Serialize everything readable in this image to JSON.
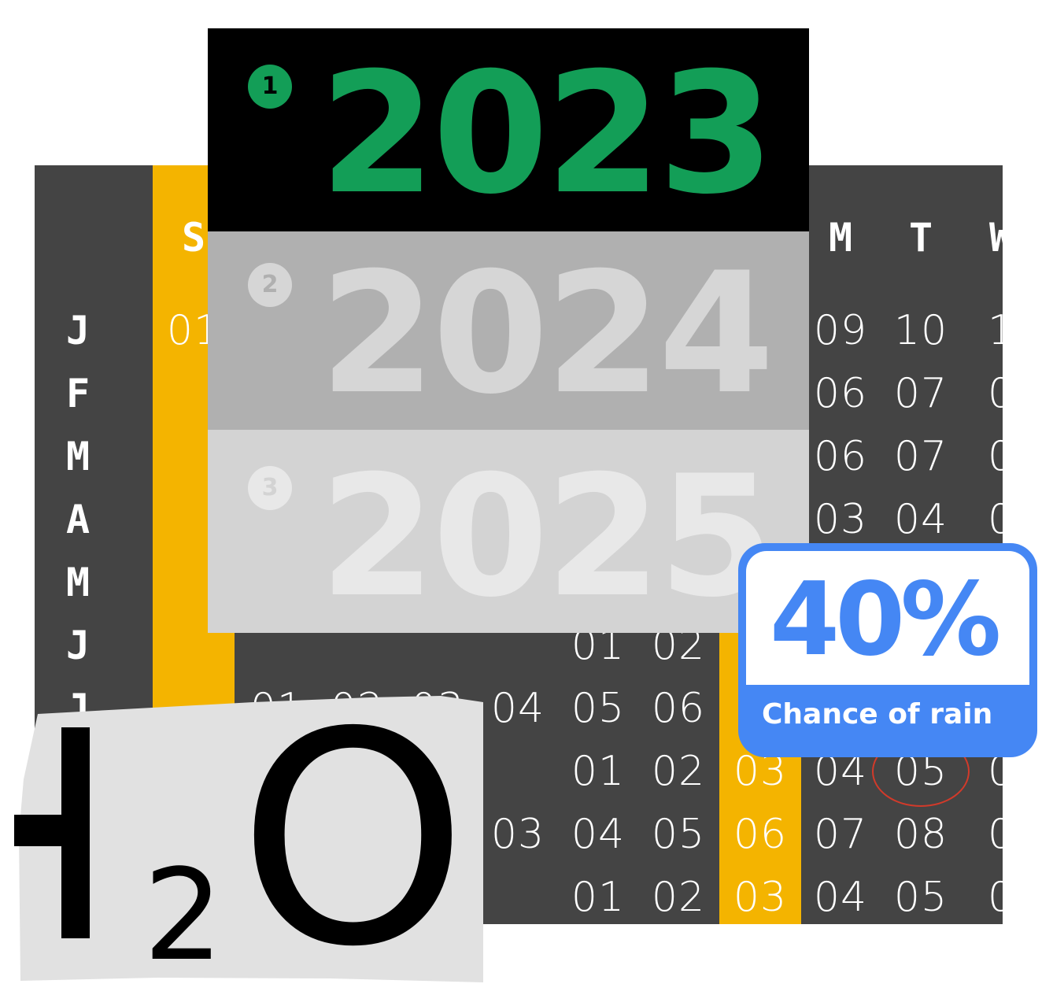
{
  "calendar": {
    "weekday_headers": [
      "S",
      "M",
      "T",
      "W"
    ],
    "months": [
      "J",
      "F",
      "M",
      "A",
      "M",
      "J",
      "J"
    ],
    "rows": [
      {
        "sun": "01",
        "mon": "09",
        "tue": "10",
        "wed": "1"
      },
      {
        "mon": "06",
        "tue": "07",
        "wed": "0"
      },
      {
        "mon": "06",
        "tue": "07",
        "wed": "0"
      },
      {
        "mon": "03",
        "tue": "04",
        "wed": "0"
      }
    ],
    "lower_rows": [
      [
        "01",
        "02"
      ],
      [
        "01",
        "02",
        "03",
        "04",
        "05",
        "06"
      ],
      [
        "01",
        "02",
        "03",
        "04",
        "05",
        "0"
      ],
      [
        "03",
        "04",
        "05",
        "06",
        "07",
        "08",
        "0"
      ],
      [
        "01",
        "02",
        "03",
        "04",
        "05",
        "0"
      ]
    ],
    "highlighted_day": "05",
    "colors": {
      "background": "#444444",
      "sunday": "#f4b400",
      "text": "#ffffff",
      "highlight_ring": "#d23a2a"
    }
  },
  "years": [
    {
      "badge": "1",
      "year": "2023",
      "bg": "#000000",
      "fg": "#139e57",
      "badge_text": "#000000"
    },
    {
      "badge": "2",
      "year": "2024",
      "bg": "#b0b0b0",
      "fg": "#d6d6d6",
      "badge_text": "#b0b0b0"
    },
    {
      "badge": "3",
      "year": "2025",
      "bg": "#d3d3d3",
      "fg": "#e8e8e8",
      "badge_text": "#d3d3d3"
    }
  ],
  "rain": {
    "value": "40%",
    "label": "Chance of rain",
    "color": "#4587f4"
  },
  "formula": {
    "main": "H",
    "subscript": "2",
    "end": "O",
    "bg": "#e1e1e1"
  }
}
